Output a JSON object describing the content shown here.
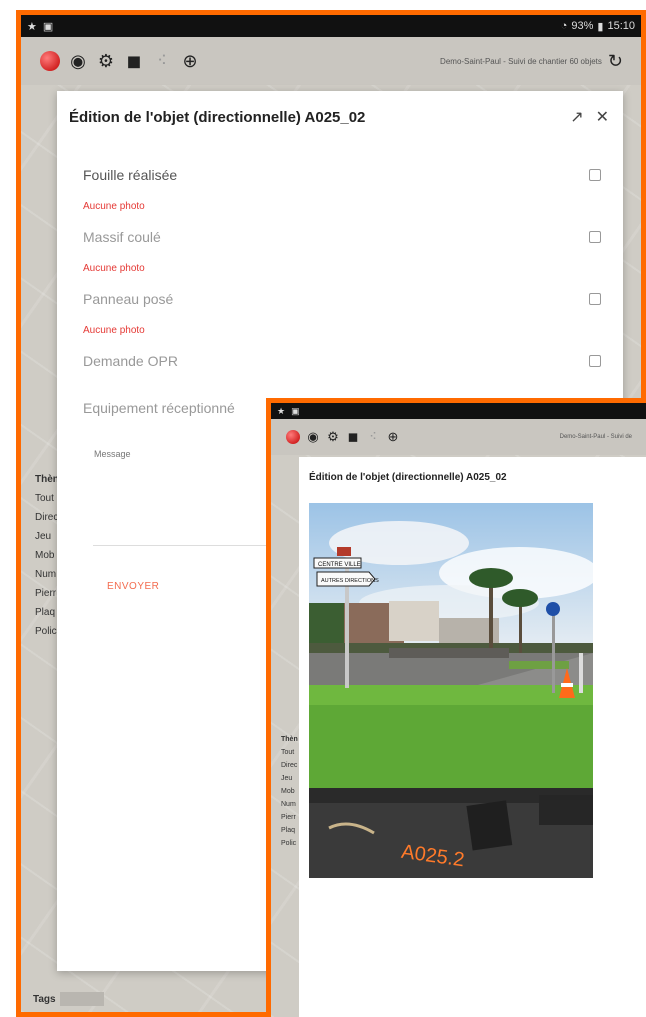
{
  "status_bar": {
    "left_icons": [
      "star-icon",
      "app-icon"
    ],
    "battery_percent": "93%",
    "time": "15:10"
  },
  "app_bar": {
    "title": "Demo-Saint-Paul - Suivi de chantier 60 objets"
  },
  "left_panel": {
    "items": [
      "Thèn",
      "Tout",
      "Direc",
      "Jeu",
      "Mob",
      "Num",
      "Pierr",
      "Plaq",
      "Polic"
    ]
  },
  "tags_label": "Tags",
  "edit_modal": {
    "title": "Édition de l'objet (directionnelle) A025_02",
    "fields": [
      {
        "label": "Fouille réalisée",
        "photo_status": "Aucune photo"
      },
      {
        "label": "Massif coulé",
        "photo_status": "Aucune photo"
      },
      {
        "label": "Panneau posé",
        "photo_status": "Aucune photo"
      },
      {
        "label": "Demande OPR"
      },
      {
        "label": "Equipement réceptionné"
      }
    ],
    "message_label": "Message",
    "send_label": "ENVOYER"
  },
  "photo_screen": {
    "status_bar": {
      "left_icons": [
        "star-icon",
        "app-icon"
      ]
    },
    "app_bar": {
      "title": "Demo-Saint-Paul - Suivi de"
    },
    "left_panel": {
      "items": [
        "Thèn",
        "Tout",
        "Direc",
        "Jeu",
        "Mob",
        "Num",
        "Pierr",
        "Plaq",
        "Polic"
      ]
    },
    "modal_title": "Édition de l'objet (directionnelle) A025_02",
    "photo": {
      "sign_top": "CENTRE VILLE",
      "sign_bottom": "AUTRES DIRECTIONS",
      "ground_marking": "A025.2"
    }
  },
  "colors": {
    "frame": "#ff6a00",
    "no_photo": "#e53935",
    "send": "#f36c4f"
  }
}
